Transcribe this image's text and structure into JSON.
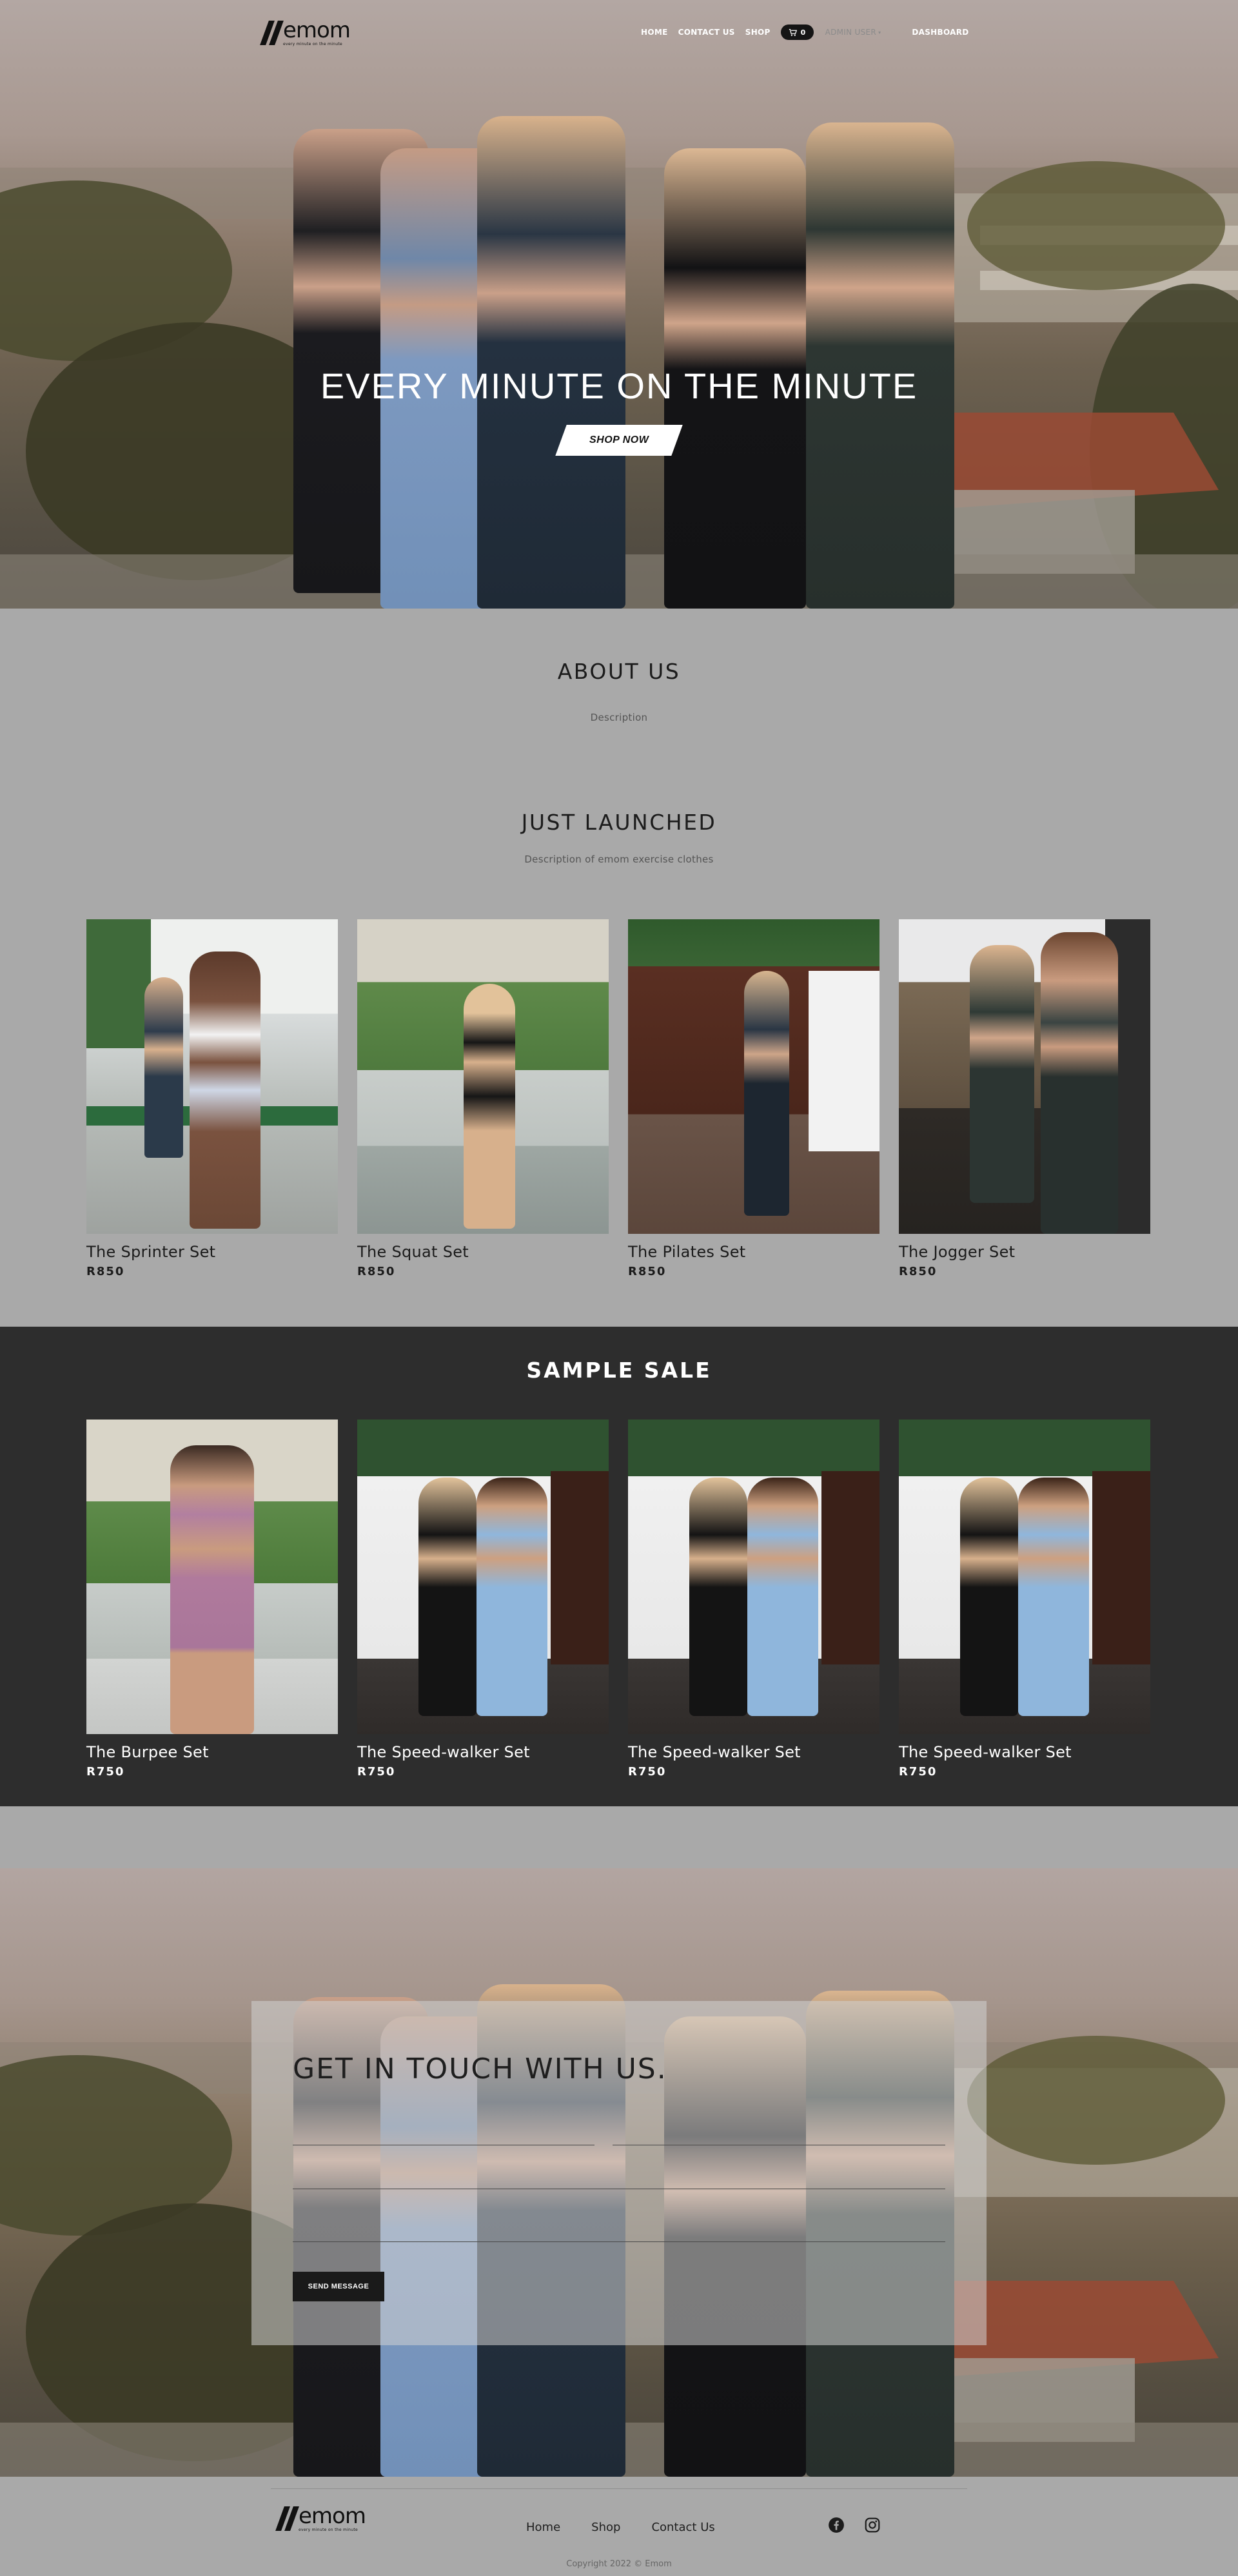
{
  "header": {
    "logo": {
      "word": "emom",
      "tagline": "every minute on the minute"
    },
    "nav": {
      "home": "HOME",
      "contact": "CONTACT US",
      "shop": "SHOP",
      "cart_count": "0",
      "admin": "ADMIN USER",
      "dashboard": "DASHBOARD"
    }
  },
  "hero": {
    "title": "EVERY MINUTE ON THE MINUTE",
    "cta": "SHOP NOW"
  },
  "about": {
    "title": "ABOUT US",
    "description": "Description"
  },
  "just_launched": {
    "title": "JUST LAUNCHED",
    "subtitle": "Description of emom exercise clothes",
    "products": [
      {
        "name": "The Sprinter Set",
        "price": "R850"
      },
      {
        "name": "The Squat Set",
        "price": "R850"
      },
      {
        "name": "The Pilates Set",
        "price": "R850"
      },
      {
        "name": "The Jogger Set",
        "price": "R850"
      }
    ]
  },
  "sample_sale": {
    "title": "SAMPLE SALE",
    "products": [
      {
        "name": "The Burpee Set",
        "price": "R750"
      },
      {
        "name": "The Speed-walker Set",
        "price": "R750"
      },
      {
        "name": "The Speed-walker Set",
        "price": "R750"
      },
      {
        "name": "The Speed-walker Set",
        "price": "R750"
      }
    ]
  },
  "contact": {
    "title": "GET IN TOUCH WITH US.",
    "send_label": "SEND MESSAGE"
  },
  "footer": {
    "links": [
      "Home",
      "Shop",
      "Contact Us"
    ],
    "social": [
      "facebook-icon",
      "instagram-icon"
    ],
    "copyright": "Copyright 2022 © Emom"
  },
  "colors": {
    "page_bg": "#a9a9a9",
    "sale_band": "#2d2d2d",
    "button_dark": "#1a1a1a"
  }
}
